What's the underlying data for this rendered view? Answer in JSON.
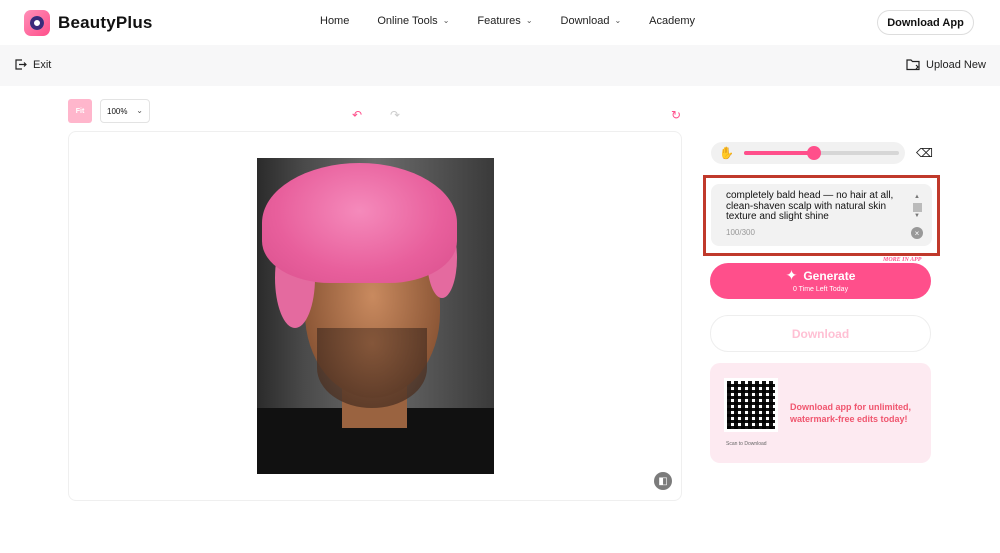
{
  "brand": {
    "name": "BeautyPlus",
    "accent": "#ff4f8b"
  },
  "nav": {
    "items": [
      {
        "label": "Home",
        "has_dropdown": false
      },
      {
        "label": "Online Tools",
        "has_dropdown": true
      },
      {
        "label": "Features",
        "has_dropdown": true
      },
      {
        "label": "Download",
        "has_dropdown": true
      },
      {
        "label": "Academy",
        "has_dropdown": false
      }
    ],
    "download_app": "Download App"
  },
  "actionbar": {
    "exit": "Exit",
    "upload_new": "Upload New"
  },
  "editor": {
    "fit": "Fit",
    "zoom": "100%",
    "brush_level": 0.45
  },
  "prompt": {
    "text": "completely bald head — no hair at all, clean-shaven scalp with natural skin texture and slight shine",
    "count": "100/300"
  },
  "generate": {
    "badge": "MORE IN APP",
    "label": "Generate",
    "sub": "0   Time Left Today"
  },
  "download": {
    "label": "Download"
  },
  "promo": {
    "qr_caption": "Scan to Download",
    "text": "Download app for unlimited, watermark-free edits today!"
  }
}
